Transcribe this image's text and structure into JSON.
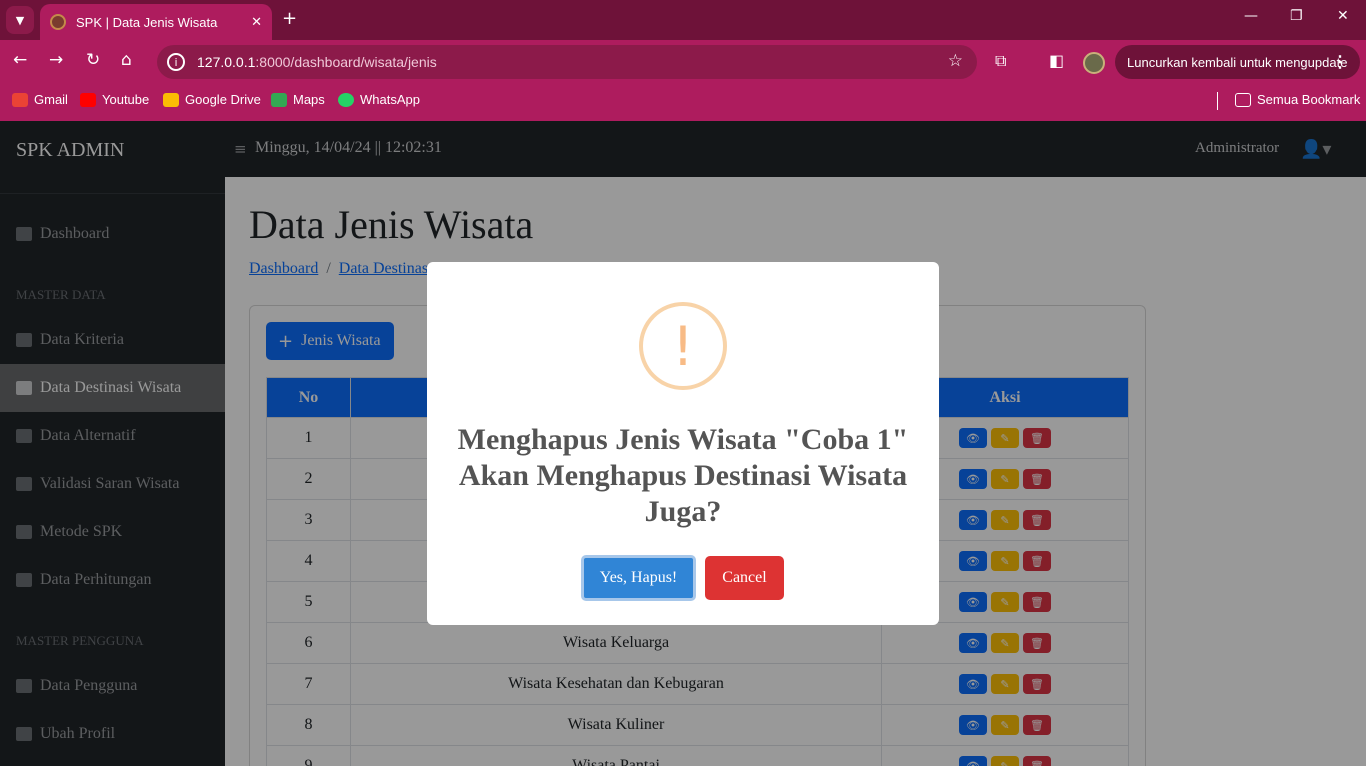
{
  "browser": {
    "tab_title": "SPK | Data Jenis Wisata",
    "tab_close": "✕",
    "new_tab": "+",
    "url_host": "127.0.0.1",
    "url_path": ":8000/dashboard/wisata/jenis",
    "relaunch_label": "Luncurkan kembali untuk mengupdate",
    "bookmarks": [
      "Gmail",
      "Youtube",
      "Google Drive",
      "Maps",
      "WhatsApp"
    ],
    "all_bookmarks": "Semua Bookmark",
    "colors": {
      "frame": "#6e1239",
      "toolbar": "#ae1c5e"
    }
  },
  "sidebar": {
    "brand": "SPK ADMIN",
    "items": [
      "Dashboard",
      "Data Kriteria",
      "Data Destinasi Wisata",
      "Data Alternatif",
      "Validasi Saran Wisata",
      "Metode SPK",
      "Data Perhitungan",
      "Data Pengguna",
      "Ubah Profil"
    ],
    "headings": [
      "MASTER DATA",
      "MASTER PENGGUNA"
    ],
    "active_item": "Data Destinasi Wisata"
  },
  "topbar": {
    "datetime": "Minggu, 14/04/24 || 12:02:31",
    "user": "Administrator"
  },
  "main": {
    "title": "Data Jenis Wisata",
    "breadcrumb": [
      "Dashboard",
      "Data Destinas"
    ],
    "add_button": "Jenis Wisata",
    "table": {
      "headers": [
        "No",
        "",
        "Aksi"
      ],
      "rows": [
        {
          "no": "1",
          "name": ""
        },
        {
          "no": "2",
          "name": ""
        },
        {
          "no": "3",
          "name": ""
        },
        {
          "no": "4",
          "name": ""
        },
        {
          "no": "5",
          "name": ""
        },
        {
          "no": "6",
          "name": "Wisata Keluarga"
        },
        {
          "no": "7",
          "name": "Wisata Kesehatan dan Kebugaran"
        },
        {
          "no": "8",
          "name": "Wisata Kuliner"
        },
        {
          "no": "9",
          "name": "Wisata Pantai"
        }
      ]
    }
  },
  "modal": {
    "icon": "!",
    "title": "Menghapus Jenis Wisata \"Coba 1\" Akan Menghapus Destinasi Wisata Juga?",
    "confirm": "Yes, Hapus!",
    "cancel": "Cancel"
  }
}
